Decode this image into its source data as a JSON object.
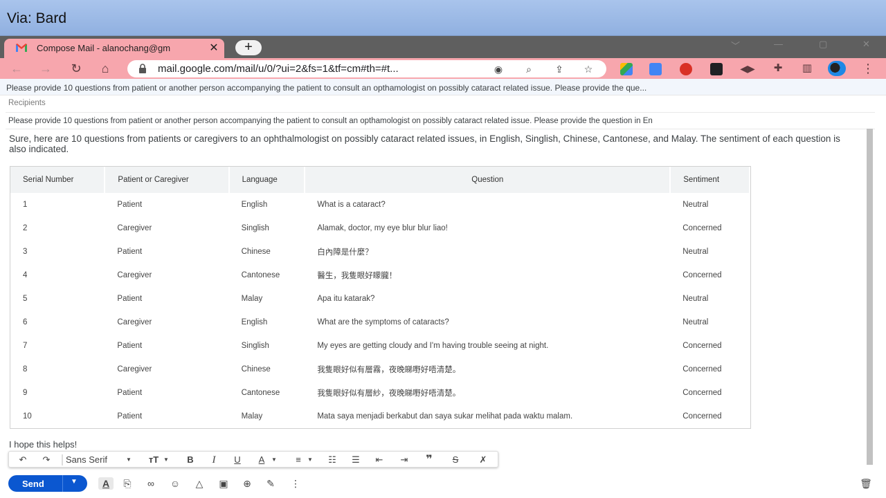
{
  "banner": {
    "text": "Via: Bard"
  },
  "browser": {
    "tab_title": "Compose Mail - alanochang@gm",
    "tab_close": "✕",
    "new_tab": "+",
    "url": "mail.google.com/mail/u/0/?ui=2&fs=1&tf=cm#th=#t...",
    "toolbar_color": "#f7a6ad"
  },
  "compose": {
    "subject": "Please provide 10 questions from patient or another person accompanying the patient to consult an opthamologist on possibly cataract related issue. Please provide the que...",
    "recipients_label": "Recipients",
    "subject_field": "Please provide 10 questions from patient or another person accompanying the patient to consult an opthamologist on possibly cataract related issue. Please provide the question in En",
    "intro": "Sure, here are 10 questions from patients or caregivers to an ophthalmologist on possibly cataract related issues, in English, Singlish, Chinese, Cantonese, and Malay. The sentiment of each question is also indicated.",
    "closing": "I hope this helps!"
  },
  "table": {
    "headers": [
      "Serial Number",
      "Patient or Caregiver",
      "Language",
      "Question",
      "Sentiment"
    ],
    "rows": [
      [
        "1",
        "Patient",
        "English",
        "What is a cataract?",
        "Neutral"
      ],
      [
        "2",
        "Caregiver",
        "Singlish",
        "Alamak, doctor, my eye blur blur liao!",
        "Concerned"
      ],
      [
        "3",
        "Patient",
        "Chinese",
        "白內障是什麼？",
        "Neutral"
      ],
      [
        "4",
        "Caregiver",
        "Cantonese",
        "醫生，我隻眼好矇朧！",
        "Concerned"
      ],
      [
        "5",
        "Patient",
        "Malay",
        "Apa itu katarak?",
        "Neutral"
      ],
      [
        "6",
        "Caregiver",
        "English",
        "What are the symptoms of cataracts?",
        "Neutral"
      ],
      [
        "7",
        "Patient",
        "Singlish",
        "My eyes are getting cloudy and I'm having trouble seeing at night.",
        "Concerned"
      ],
      [
        "8",
        "Caregiver",
        "Chinese",
        "我隻眼好似有層霧，夜晚睇嘢好唔清楚。",
        "Concerned"
      ],
      [
        "9",
        "Patient",
        "Cantonese",
        "我隻眼好似有層紗，夜晚睇嘢好唔清楚。",
        "Concerned"
      ],
      [
        "10",
        "Patient",
        "Malay",
        "Mata saya menjadi berkabut dan saya sukar melihat pada waktu malam.",
        "Concerned"
      ]
    ]
  },
  "format_bar": {
    "font": "Sans Serif",
    "undo": "↶",
    "redo": "↷",
    "size": "тT",
    "bold": "B",
    "italic": "I",
    "underline": "U",
    "color": "A"
  },
  "send_label": "Send",
  "icons": [
    "gmail-icon",
    "back-icon",
    "forward-icon",
    "reload-icon",
    "home-icon",
    "lock-icon",
    "eye-icon",
    "zoom-icon",
    "share-icon",
    "star-icon",
    "attach-icon",
    "link-icon",
    "emoji-icon",
    "drive-icon",
    "photo-icon",
    "lock-clock-icon",
    "signature-icon",
    "more-icon",
    "trash-icon"
  ]
}
